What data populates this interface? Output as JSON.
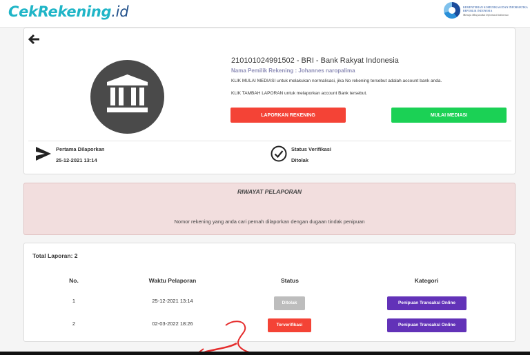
{
  "header": {
    "logo_main": "CekRekening",
    "logo_suffix": ".id",
    "kominfo_line1": "KEMENTERIAN KOMUNIKASI DAN INFORMATIKA",
    "kominfo_line2": "REPUBLIK INDONESIA",
    "kominfo_line3": "Menuju Masyarakat Informasi Indonesia"
  },
  "account": {
    "title": "210101024991502 - BRI - Bank Rakyat Indonesia",
    "owner": "Nama Pemilik Rekening : Johannes naropalima",
    "note_mediasi": "KLIK MULAI MEDIASI untuk melakukan normalisasi, jika No rekening tersebut adalah account bank anda.",
    "note_laporan": "KLIK TAMBAH LAPORAN untuk melaporkan account Bank tersebut.",
    "report_button": "LAPORKAN REKENING",
    "mediation_button": "MULAI MEDIASI",
    "first_reported_label": "Pertama Dilaporkan",
    "first_reported_value": "25-12-2021 13:14",
    "verification_label": "Status Verifikasi",
    "verification_value": "Ditolak"
  },
  "history": {
    "title": "RIWAYAT PELAPORAN",
    "message": "Nomor rekening yang anda cari pernah dilaporkan dengan dugaan tindak penipuan"
  },
  "reports": {
    "total_label": "Total Laporan:",
    "total_value": "2",
    "columns": [
      "No.",
      "Waktu Pelaporan",
      "Status",
      "Kategori"
    ],
    "rows": [
      {
        "no": "1",
        "time": "25-12-2021 13:14",
        "status": "Ditolak",
        "category": "Penipuan Transaksi Online"
      },
      {
        "no": "2",
        "time": "02-03-2022 18:26",
        "status": "Terverifikasi",
        "category": "Penipuan Transaksi Online"
      }
    ]
  },
  "colors": {
    "brand": "#1fb5c7",
    "danger": "#f44336",
    "success": "#1bd155",
    "category": "#6232b8",
    "rejected": "#bdbdbd",
    "history_bg": "#f2dede"
  }
}
